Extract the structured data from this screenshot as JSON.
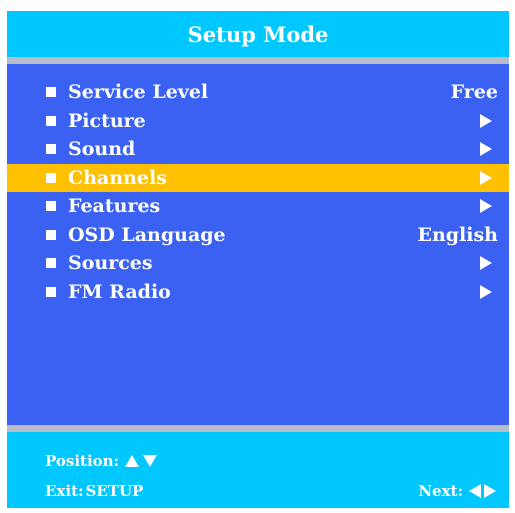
{
  "header": {
    "title": "Setup Mode"
  },
  "menu": {
    "items": [
      {
        "label": "Service Level",
        "value": "Free"
      },
      {
        "label": "Picture",
        "icon": "arrow-right-icon"
      },
      {
        "label": "Sound",
        "icon": "arrow-right-icon"
      },
      {
        "label": "Channels",
        "icon": "arrow-right-icon",
        "selected": true
      },
      {
        "label": "Features",
        "icon": "arrow-right-icon"
      },
      {
        "label": "OSD Language",
        "value": "English"
      },
      {
        "label": "Sources",
        "icon": "arrow-right-icon"
      },
      {
        "label": "FM Radio",
        "icon": "arrow-right-icon"
      }
    ]
  },
  "footer": {
    "position_label": "Position:",
    "exit_label": "Exit:",
    "exit_key": "SETUP",
    "next_label": "Next:"
  },
  "colors": {
    "header_bg": "#00c8ff",
    "menu_bg": "#3a61f2",
    "selected_bg": "#ffc000",
    "separator": "#b8bcc8",
    "text": "#ffffff"
  }
}
